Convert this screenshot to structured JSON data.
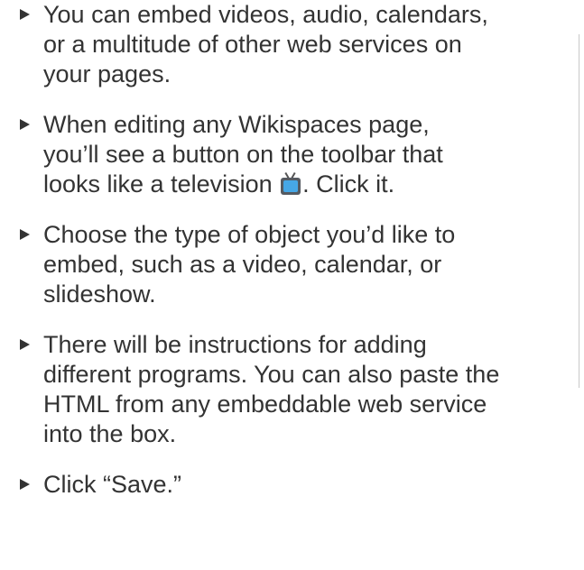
{
  "bullets": [
    {
      "lines": [
        "You can embed videos, audio, calendars,",
        "or a multitude of other web services on",
        "your pages."
      ]
    },
    {
      "lines": [
        "When editing any Wikispaces page,",
        "you’ll see a button on the toolbar that"
      ],
      "icon_line_before": "looks like a television",
      "icon": "television-icon",
      "icon_line_after": ". Click it."
    },
    {
      "lines": [
        "Choose the type of object you’d like to",
        "embed, such as a video, calendar, or",
        "slideshow."
      ]
    },
    {
      "lines": [
        "There will be instructions for adding",
        "different programs. You can also paste the",
        "HTML from any embeddable web service",
        "into the box."
      ]
    },
    {
      "lines": [
        "Click “Save.”"
      ]
    }
  ]
}
